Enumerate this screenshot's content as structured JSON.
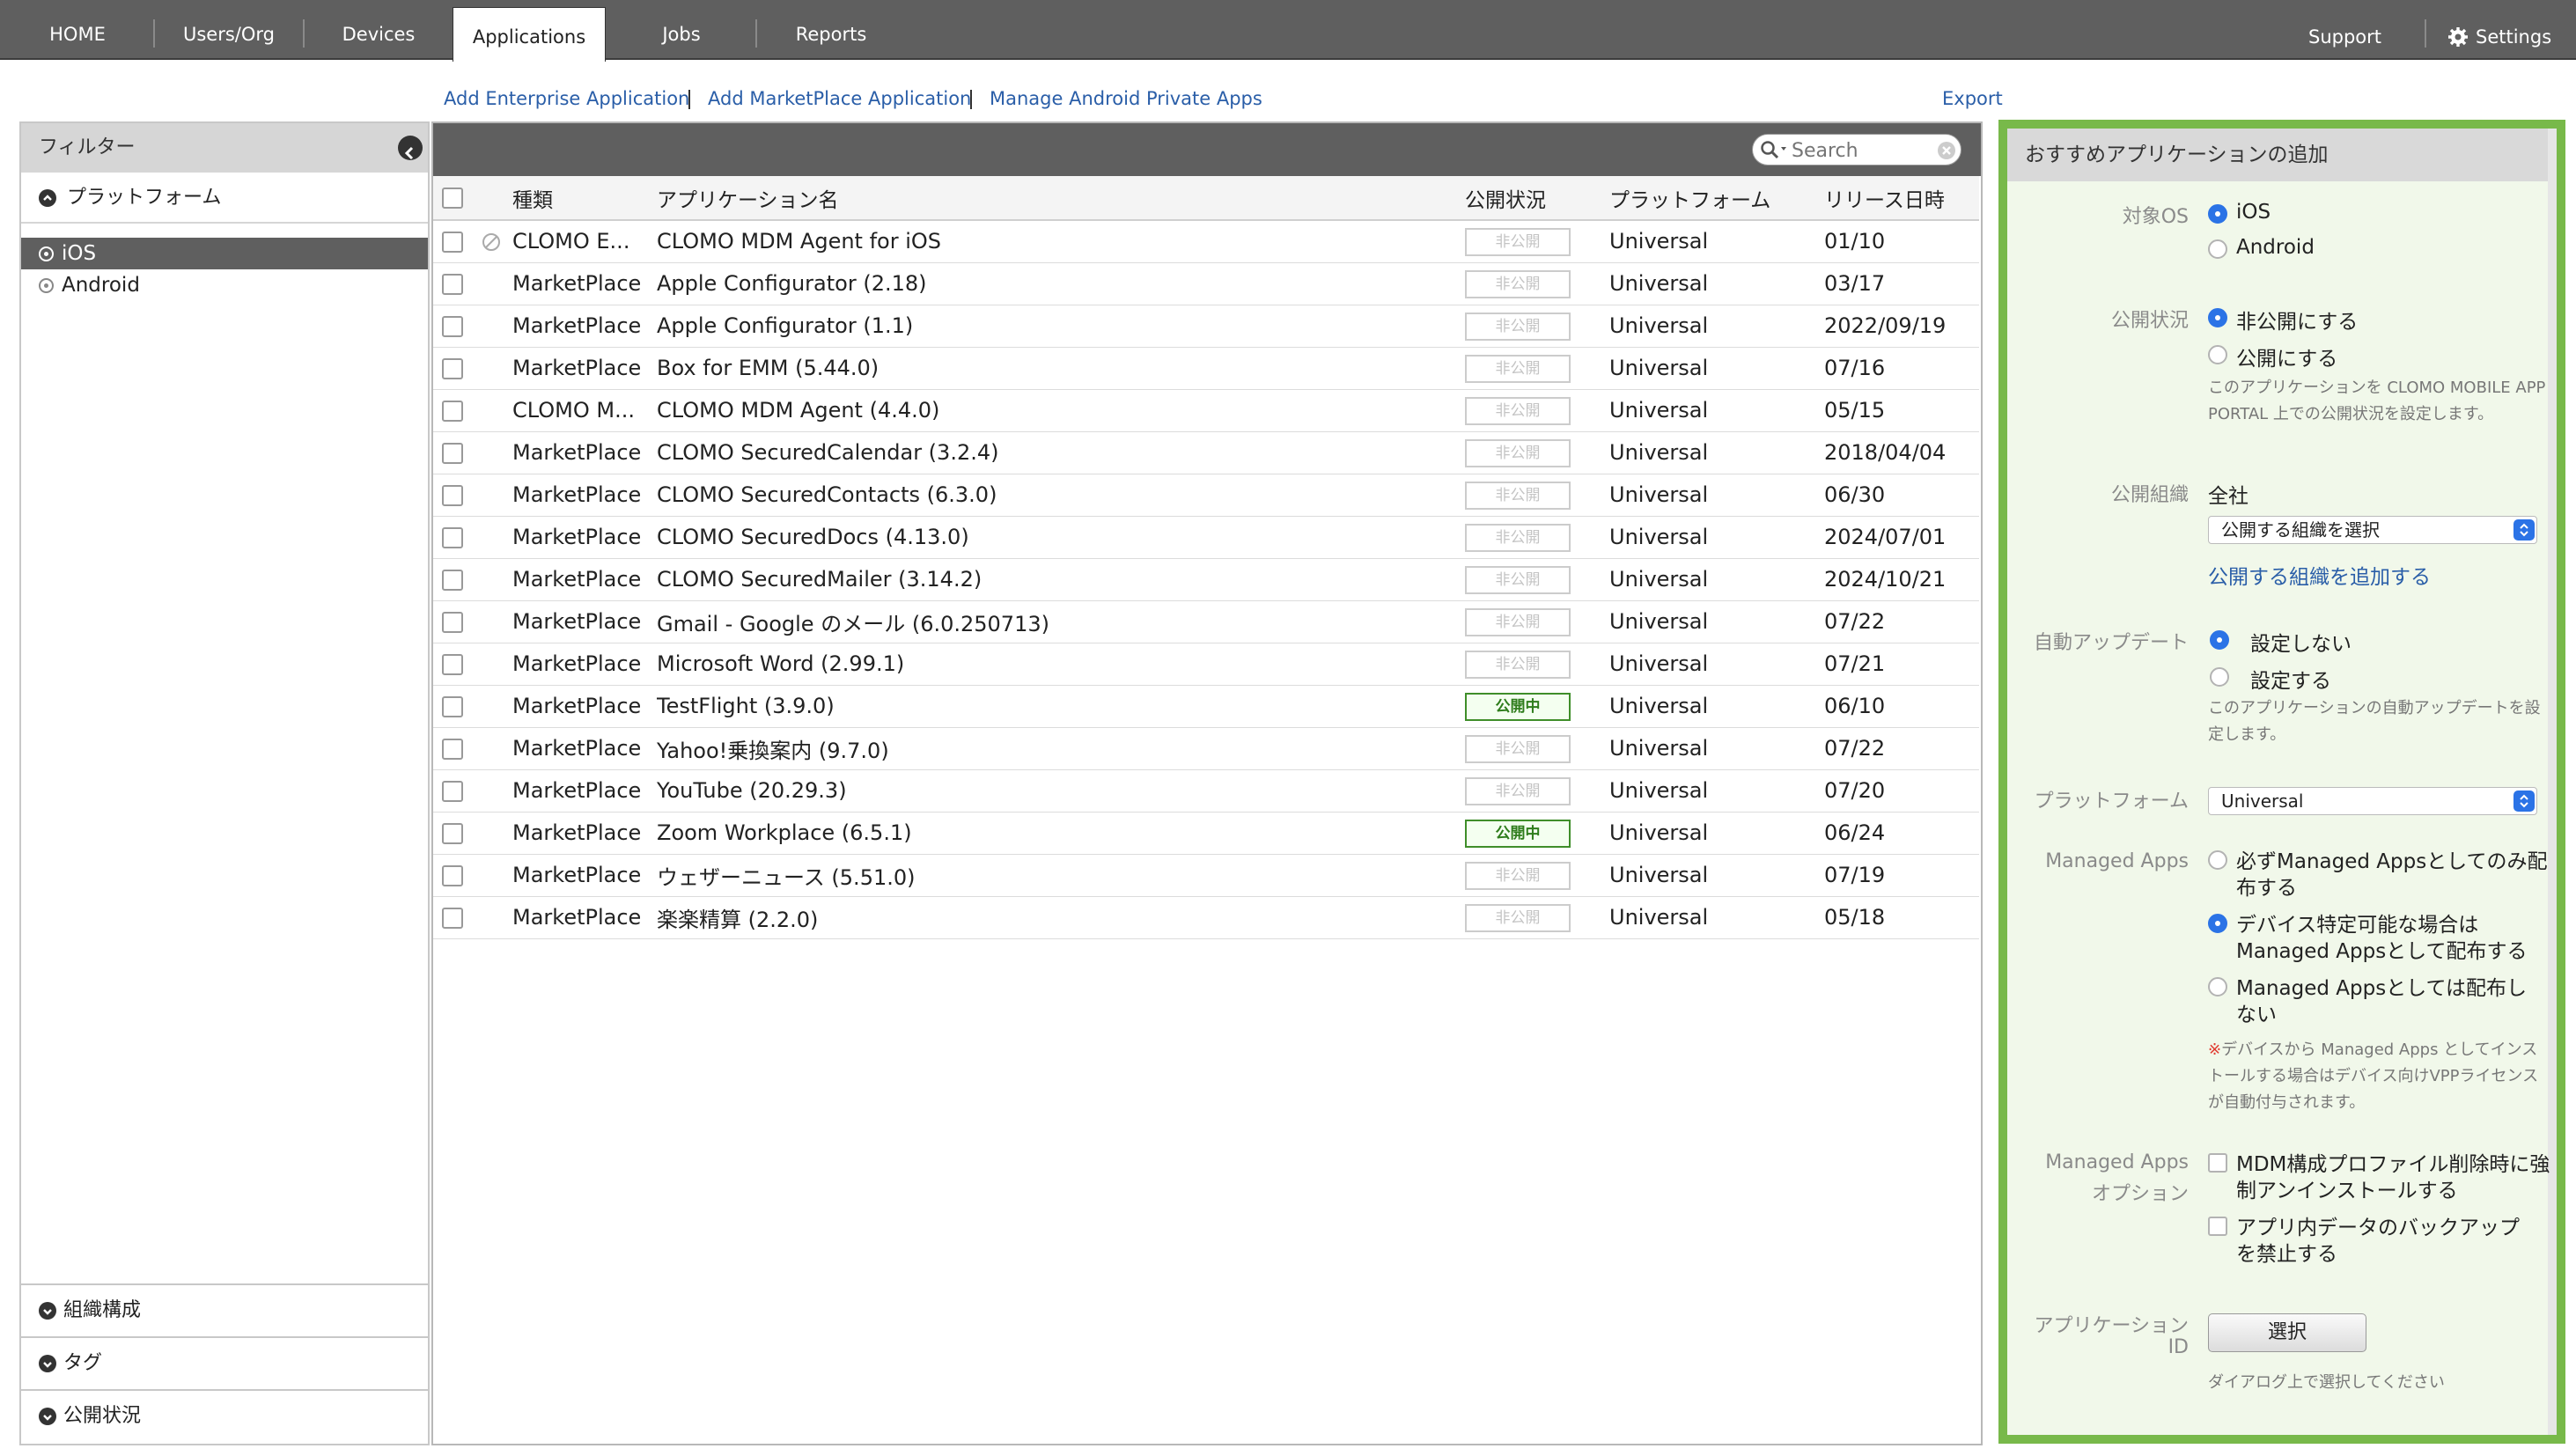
{
  "nav": {
    "tabs": [
      "HOME",
      "Users/Org",
      "Devices",
      "Applications",
      "Jobs",
      "Reports"
    ],
    "active": "Applications",
    "support": "Support",
    "settings": "Settings"
  },
  "sublinks": {
    "add_enterprise": "Add Enterprise Application",
    "add_marketplace": "Add MarketPlace Application",
    "manage_android": "Manage Android Private Apps",
    "export": "Export"
  },
  "filter": {
    "title": "フィルター",
    "platform_section": "プラットフォーム",
    "items": [
      "iOS",
      "Android"
    ],
    "selected": "iOS",
    "bottom_sections": [
      "組織構成",
      "タグ",
      "公開状況"
    ]
  },
  "search": {
    "placeholder": "Search"
  },
  "table": {
    "headers": [
      "種類",
      "アプリケーション名",
      "公開状況",
      "プラットフォーム",
      "リリース日時"
    ],
    "rows": [
      {
        "type": "CLOMO E...",
        "name": "CLOMO MDM Agent for iOS",
        "status": "非公開",
        "platform": "Universal",
        "date": "01/10",
        "disabled": true
      },
      {
        "type": "MarketPlace",
        "name": "Apple Configurator (2.18)",
        "status": "非公開",
        "platform": "Universal",
        "date": "03/17"
      },
      {
        "type": "MarketPlace",
        "name": "Apple Configurator (1.1)",
        "status": "非公開",
        "platform": "Universal",
        "date": "2022/09/19"
      },
      {
        "type": "MarketPlace",
        "name": "Box for EMM (5.44.0)",
        "status": "非公開",
        "platform": "Universal",
        "date": "07/16"
      },
      {
        "type": "CLOMO M...",
        "name": "CLOMO MDM Agent (4.4.0)",
        "status": "非公開",
        "platform": "Universal",
        "date": "05/15"
      },
      {
        "type": "MarketPlace",
        "name": "CLOMO SecuredCalendar (3.2.4)",
        "status": "非公開",
        "platform": "Universal",
        "date": "2018/04/04"
      },
      {
        "type": "MarketPlace",
        "name": "CLOMO SecuredContacts (6.3.0)",
        "status": "非公開",
        "platform": "Universal",
        "date": "06/30"
      },
      {
        "type": "MarketPlace",
        "name": "CLOMO SecuredDocs (4.13.0)",
        "status": "非公開",
        "platform": "Universal",
        "date": "2024/07/01"
      },
      {
        "type": "MarketPlace",
        "name": "CLOMO SecuredMailer (3.14.2)",
        "status": "非公開",
        "platform": "Universal",
        "date": "2024/10/21"
      },
      {
        "type": "MarketPlace",
        "name": "Gmail - Google のメール (6.0.250713)",
        "status": "非公開",
        "platform": "Universal",
        "date": "07/22"
      },
      {
        "type": "MarketPlace",
        "name": "Microsoft Word (2.99.1)",
        "status": "非公開",
        "platform": "Universal",
        "date": "07/21"
      },
      {
        "type": "MarketPlace",
        "name": "TestFlight (3.9.0)",
        "status": "公開中",
        "platform": "Universal",
        "date": "06/10"
      },
      {
        "type": "MarketPlace",
        "name": "Yahoo!乗換案内 (9.7.0)",
        "status": "非公開",
        "platform": "Universal",
        "date": "07/22"
      },
      {
        "type": "MarketPlace",
        "name": "YouTube (20.29.3)",
        "status": "非公開",
        "platform": "Universal",
        "date": "07/20"
      },
      {
        "type": "MarketPlace",
        "name": "Zoom Workplace (6.5.1)",
        "status": "公開中",
        "platform": "Universal",
        "date": "06/24"
      },
      {
        "type": "MarketPlace",
        "name": "ウェザーニュース (5.51.0)",
        "status": "非公開",
        "platform": "Universal",
        "date": "07/19"
      },
      {
        "type": "MarketPlace",
        "name": "楽楽精算 (2.2.0)",
        "status": "非公開",
        "platform": "Universal",
        "date": "05/18"
      }
    ]
  },
  "panel": {
    "title": "おすすめアプリケーションの追加",
    "target_os": {
      "label": "対象OS",
      "options": [
        "iOS",
        "Android"
      ],
      "selected": "iOS"
    },
    "publish": {
      "label": "公開状況",
      "options": [
        "非公開にする",
        "公開にする"
      ],
      "selected": "非公開にする",
      "note": "このアプリケーションを CLOMO MOBILE APP PORTAL 上での公開状況を設定します。"
    },
    "org": {
      "label": "公開組織",
      "value": "全社",
      "select": "公開する組織を選択",
      "add_link": "公開する組織を追加する"
    },
    "auto_update": {
      "label": "自動アップデート",
      "options": [
        "設定しない",
        "設定する"
      ],
      "selected": "設定しない",
      "note": "このアプリケーションの自動アップデートを設定します。"
    },
    "platform": {
      "label": "プラットフォーム",
      "value": "Universal"
    },
    "managed": {
      "label": "Managed Apps",
      "options": [
        "必ずManaged Appsとしてのみ配布する",
        "デバイス特定可能な場合は Managed Appsとして配布する",
        "Managed Appsとしては配布しない"
      ],
      "selected": 1,
      "note_mark": "※",
      "note": "デバイスから Managed Apps としてインストールする場合はデバイス向けVPPライセンスが自動付与されます。"
    },
    "managed_opt": {
      "label1": "Managed Apps",
      "label2": "オプション",
      "options": [
        "MDM構成プロファイル削除時に強制アンインストールする",
        "アプリ内データのバックアップを禁止する"
      ]
    },
    "app_id": {
      "label1": "アプリケーション",
      "label2": "ID",
      "button": "選択",
      "note": "ダイアログ上で選択してください"
    }
  }
}
